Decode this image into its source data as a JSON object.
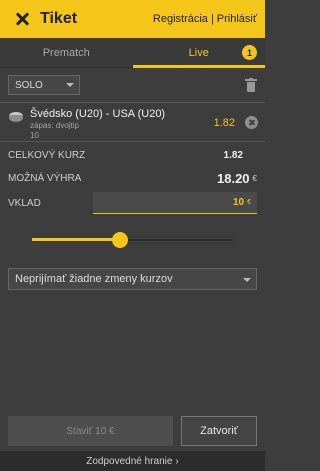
{
  "header": {
    "title": "Tiket",
    "register_label": "Registrácia",
    "separator": "|",
    "login_label": "Prihlásiť"
  },
  "tabs": [
    {
      "label": "Prematch",
      "active": false
    },
    {
      "label": "Live",
      "active": true,
      "badge": "1"
    }
  ],
  "bet_type": {
    "selected": "SOLO"
  },
  "selection": {
    "match": "Švédsko (U20) - USA (U20)",
    "market": "zápas: dvojtip",
    "pick": "10",
    "odds": "1.82"
  },
  "summary": {
    "total_odds_label": "CELKOVÝ KURZ",
    "total_odds_value": "1.82",
    "possible_win_label": "MOŽNÁ VÝHRA",
    "possible_win_value": "18.20",
    "currency": "€"
  },
  "stake": {
    "label": "VKLAD",
    "value": "10",
    "currency": "€",
    "slider_fraction": 0.44
  },
  "odds_change": {
    "selected": "Neprijímať žiadne zmeny kurzov"
  },
  "actions": {
    "place_label": "Staviť 10 €",
    "close_label": "Zatvoriť"
  },
  "footer": {
    "label": "Zodpovedné hranie",
    "chevron": "›"
  },
  "colors": {
    "accent": "#f5c61a",
    "background": "#3d3d3d"
  }
}
